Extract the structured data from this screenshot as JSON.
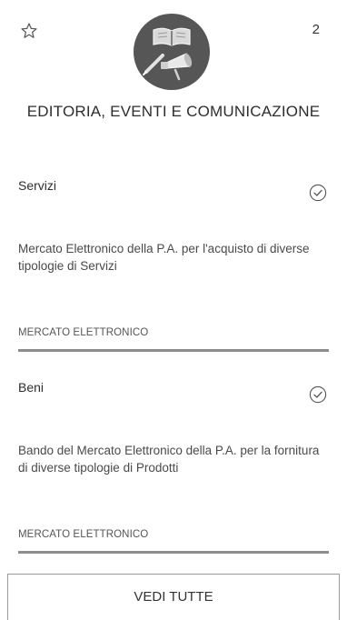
{
  "header": {
    "count": "2",
    "icons": {
      "favorite": "star-outline-icon",
      "category": "books-and-megaphone-icon"
    }
  },
  "category": {
    "title": "EDITORIA, EVENTI E COMUNICAZIONE"
  },
  "items": [
    {
      "title": "Servizi",
      "icon": "check-circle-icon",
      "description": "Mercato Elettronico della P.A. per l'acquisto di diverse tipologie di Servizi",
      "type": "MERCATO ELETTRONICO"
    },
    {
      "title": "Beni",
      "icon": "check-circle-icon",
      "description": "Bando del Mercato Elettronico della P.A. per la fornitura di diverse tipologie di Prodotti",
      "type": "MERCATO ELETTRONICO"
    }
  ],
  "footer": {
    "see_all_label": "VEDI TUTTE"
  },
  "colors": {
    "icon_circle": "#565656",
    "divider": "#8d8d8d",
    "text": "#2e2e2e"
  }
}
